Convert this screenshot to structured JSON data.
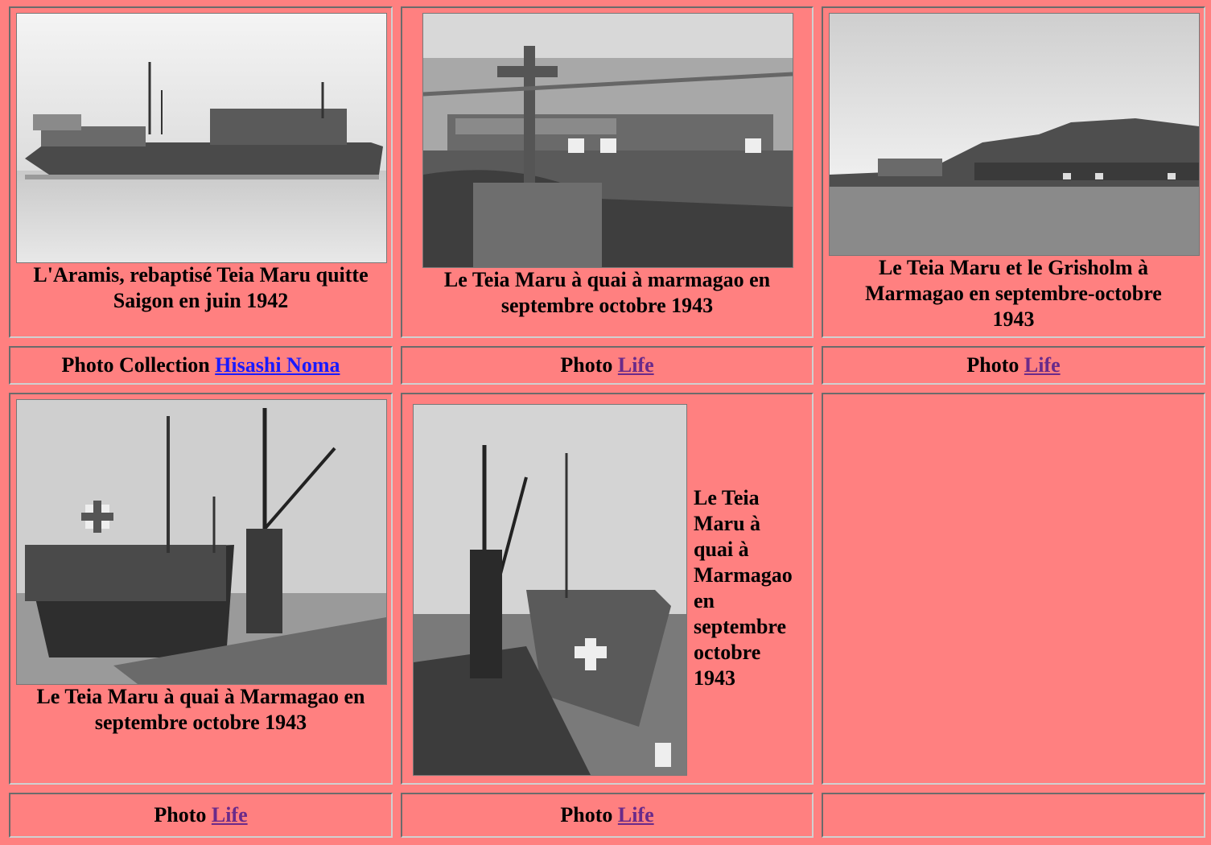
{
  "colors": {
    "background": "#ff8080",
    "link_unvisited": "#1a1aff",
    "link_visited": "#6a2a8a"
  },
  "row1": {
    "cell1": {
      "caption": "L'Aramis, rebaptisé Teia Maru quitte Saigon en juin 1942"
    },
    "cell2": {
      "caption": "Le Teia Maru à quai à marmagao en septembre octobre 1943"
    },
    "cell3": {
      "caption": "Le Teia Maru et le Grisholm à Marmagao en septembre-octobre 1943"
    }
  },
  "credits1": {
    "cell1": {
      "prefix": "Photo Collection",
      "link": "Hisashi Noma"
    },
    "cell2": {
      "prefix": "Photo",
      "link": "Life"
    },
    "cell3": {
      "prefix": "Photo",
      "link": "Life"
    }
  },
  "row2": {
    "cell1": {
      "caption": "Le Teia Maru à quai à Marmagao en septembre octobre 1943"
    },
    "cell2": {
      "caption_lines": [
        "Le Teia",
        "Maru à",
        "quai à",
        "Marmagao",
        "en",
        "septembre",
        "octobre",
        "1943"
      ]
    }
  },
  "credits2": {
    "cell1": {
      "prefix": "Photo",
      "link": "Life"
    },
    "cell2": {
      "prefix": "Photo",
      "link": "Life"
    }
  }
}
